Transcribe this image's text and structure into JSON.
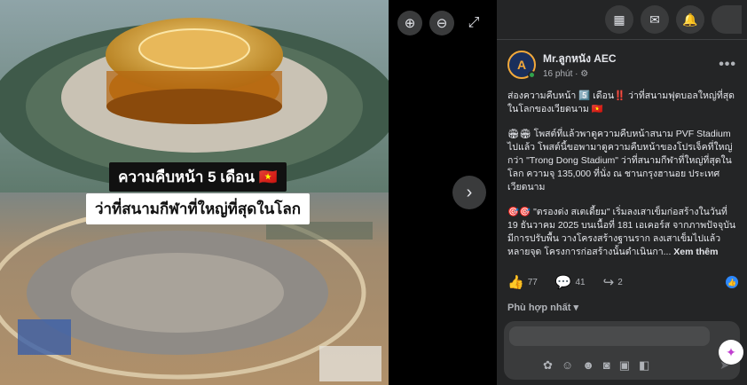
{
  "viewer": {
    "caption_line1": "ความคืบหน้า 5 เดือน 🇻🇳",
    "caption_line2": "ว่าที่สนามกีฬาที่ใหญ่ที่สุดในโลก",
    "zoom_in_icon": "zoom-in-icon",
    "zoom_out_icon": "zoom-out-icon",
    "expand_icon": "expand-icon",
    "next_icon": "chevron-right-icon"
  },
  "nav": {
    "menu_icon": "grid-menu-icon",
    "messenger_icon": "messenger-icon",
    "bell_icon": "bell-icon"
  },
  "post": {
    "author": "Mr.ลูกหนัง AEC",
    "time": "16 phút",
    "privacy_icon": "globe-icon",
    "more_label": "•••",
    "body_p1": "ส่องความคืบหน้า 5️⃣ เดือน‼️ ว่าที่สนามฟุตบอลใหญ่ที่สุดในโลกของเวียดนาม 🇻🇳",
    "body_p2": "🏟🏟 โพสต์ที่แล้วพาดูความคืบหน้าสนาม PVF Stadium ไปแล้ว โพสต์นี้ขอพามาดูความคืบหน้าของโปรเจ็คที่ใหญ่กว่า \"Trong Dong Stadium\" ว่าที่สนามกีฬาที่ใหญ่ที่สุดในโลก ความจุ 135,000 ที่นั่ง ณ ชานกรุงฮานอย ประเทศเวียดนาม",
    "body_p3": "🎯🎯 \"ตรองด่ง สเตเดี้ยม\" เริ่มลงเสาเข็มก่อสร้างในวันที่ 19 ธันวาคม 2025 บนเนื้อที่ 181 เอเคอร์ส จากภาพปัจจุบันมีการปรับพื้น วางโครงสร้างฐานราก ลงเสาเข็มไปแล้วหลายจุด โครงการก่อสร้างนั้นดำเนินกา...",
    "see_more": "Xem thêm",
    "likes": "77",
    "comments": "41",
    "shares": "2",
    "sort_label": "Phù hợp nhất"
  }
}
